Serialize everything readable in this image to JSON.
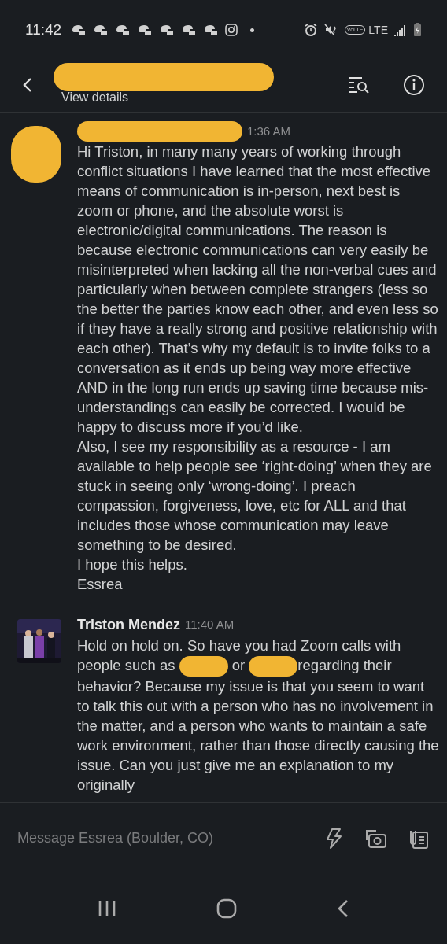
{
  "status_bar": {
    "time": "11:42",
    "notification_icons": [
      {
        "kind": "chat"
      },
      {
        "kind": "chat"
      },
      {
        "kind": "chat"
      },
      {
        "kind": "chat"
      },
      {
        "kind": "chat"
      },
      {
        "kind": "chat"
      },
      {
        "kind": "chat"
      },
      {
        "kind": "camera"
      },
      {
        "kind": "dot"
      }
    ],
    "volte": "VoLTE",
    "network": "LTE"
  },
  "header": {
    "title": {
      "kind": "redaction"
    },
    "subtitle": "View details"
  },
  "messages": [
    {
      "avatar": {
        "kind": "redaction"
      },
      "sender": {
        "kind": "redaction"
      },
      "time": "1:36 AM",
      "paragraphs": [
        [
          {
            "kind": "text",
            "text": "Hi Triston, in many many years of working through conflict situations I have learned that the most effective means of communication is in-person, next best is zoom or phone, and the absolute worst is electronic/digital communications. The reason is because electronic communications can very easily be misinterpreted when lacking all the non-verbal cues and particularly when between complete strangers (less so the better the parties know each other, and even less so if they have a really strong and positive relationship with each other). That’s why my default is to invite folks to a conversation as it ends up being way more effective AND in the long run ends up saving time because mis-understandings can easily be corrected. I would be happy to discuss more if you’d like."
          }
        ],
        [
          {
            "kind": "text",
            "text": "Also, I see my responsibility as a resource - I am available to help people see ‘right-doing’ when they are stuck in seeing only ‘wrong-doing’. I preach compassion, forgiveness, love, etc for ALL and that includes those whose communication may leave something to be desired."
          }
        ],
        [
          {
            "kind": "text",
            "text": "I hope this helps."
          }
        ],
        [
          {
            "kind": "text",
            "text": "Essrea"
          }
        ]
      ]
    },
    {
      "avatar": {
        "kind": "picture"
      },
      "sender": {
        "kind": "text",
        "text": "Triston Mendez"
      },
      "time": "11:40 AM",
      "paragraphs": [
        [
          {
            "kind": "text",
            "text": "Hold on hold on. So have you had Zoom calls with people such as "
          },
          {
            "kind": "redaction"
          },
          {
            "kind": "text",
            "text": " or "
          },
          {
            "kind": "redaction"
          },
          {
            "kind": "text",
            "text": "regarding their behavior? Because my issue is that you seem to want to talk this out with a person who has no involvement in the matter, and a person who wants to maintain a safe work environment, rather than those directly causing the issue. Can you just give me an explanation to my originally"
          }
        ]
      ]
    }
  ],
  "composer": {
    "placeholder": "Message Essrea (Boulder, CO)"
  }
}
